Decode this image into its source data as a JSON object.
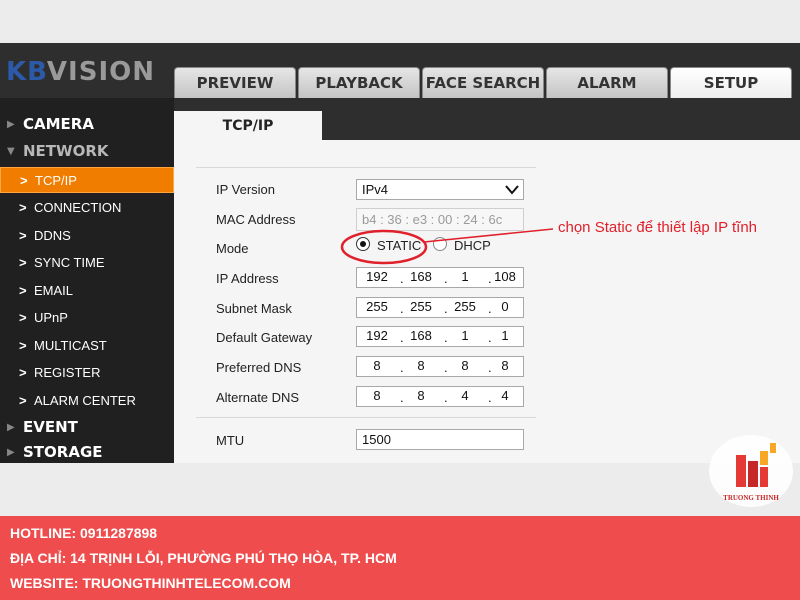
{
  "brand": {
    "logo_kb": "KB",
    "logo_vision": "VISION"
  },
  "main_tabs": [
    {
      "label": "PREVIEW"
    },
    {
      "label": "PLAYBACK"
    },
    {
      "label": "FACE SEARCH"
    },
    {
      "label": "ALARM"
    },
    {
      "label": "SETUP",
      "active": true
    }
  ],
  "sidebar": {
    "categories": {
      "camera": "CAMERA",
      "network": "NETWORK",
      "event": "EVENT",
      "storage": "STORAGE"
    },
    "network_items": [
      "TCP/IP",
      "CONNECTION",
      "DDNS",
      "SYNC TIME",
      "EMAIL",
      "UPnP",
      "MULTICAST",
      "REGISTER",
      "ALARM CENTER"
    ],
    "active_item": "TCP/IP"
  },
  "content": {
    "tab": "TCP/IP",
    "fields": {
      "ip_version": {
        "label": "IP Version",
        "value": "IPv4"
      },
      "mac": {
        "label": "MAC Address",
        "value": "b4 : 36 : e3 : 00 : 24 : 6c"
      },
      "mode": {
        "label": "Mode",
        "static": "STATIC",
        "dhcp": "DHCP",
        "selected": "STATIC"
      },
      "ip": {
        "label": "IP Address",
        "octets": [
          "192",
          "168",
          "1",
          "108"
        ]
      },
      "subnet": {
        "label": "Subnet Mask",
        "octets": [
          "255",
          "255",
          "255",
          "0"
        ]
      },
      "gateway": {
        "label": "Default Gateway",
        "octets": [
          "192",
          "168",
          "1",
          "1"
        ]
      },
      "dns1": {
        "label": "Preferred DNS",
        "octets": [
          "8",
          "8",
          "8",
          "8"
        ]
      },
      "dns2": {
        "label": "Alternate DNS",
        "octets": [
          "8",
          "8",
          "4",
          "4"
        ]
      },
      "mtu": {
        "label": "MTU",
        "value": "1500"
      }
    }
  },
  "annotation": {
    "text": "chọn Static để thiết lập IP tĩnh",
    "color": "#e0202a"
  },
  "watermark": {
    "text": "TRUONG THINH"
  },
  "footer": {
    "hotline": "HOTLINE: 0911287898",
    "address": "ĐỊA CHỈ: 14 TRỊNH LỖI, PHƯỜNG PHÚ THỌ HÒA, TP. HCM",
    "website": "WEBSITE: TRUONGTHINHTELECOM.COM",
    "color": "#ef4d4d"
  },
  "colors": {
    "accent": "#f07d00",
    "header_bg": "#2e2e2e",
    "sidebar_bg": "#202020"
  }
}
